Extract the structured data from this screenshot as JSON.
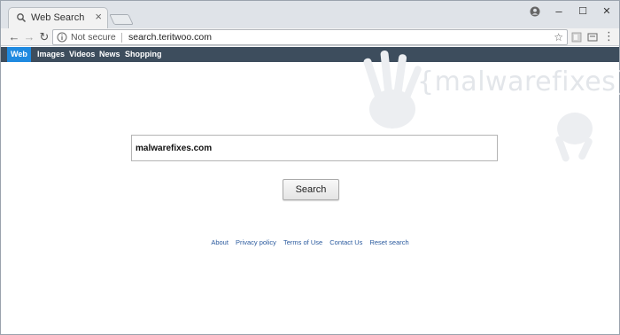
{
  "browser": {
    "tab": {
      "title": "Web Search",
      "icon": "search-icon"
    },
    "window_controls": {
      "minimize": "–",
      "maximize": "☐",
      "close": "✕"
    },
    "address": {
      "security_label": "Not secure",
      "url": "search.teritwoo.com"
    }
  },
  "nav": {
    "items": [
      {
        "label": "Web",
        "active": true
      },
      {
        "label": "Images",
        "active": false
      },
      {
        "label": "Videos",
        "active": false
      },
      {
        "label": "News",
        "active": false
      },
      {
        "label": "Shopping",
        "active": false
      }
    ]
  },
  "watermark": {
    "text": "{malwarefixes}"
  },
  "search": {
    "value": "malwarefixes.com",
    "button_label": "Search"
  },
  "footer": {
    "links": [
      "About",
      "Privacy policy",
      "Terms of Use",
      "Contact Us",
      "Reset search"
    ]
  },
  "colors": {
    "nav_bg": "#3d4d5d",
    "nav_active": "#1f8ae0",
    "link": "#2a5a9e"
  }
}
